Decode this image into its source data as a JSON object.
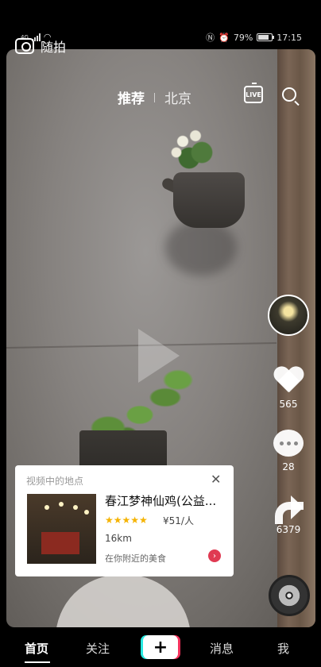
{
  "status_bar": {
    "network": "4G",
    "battery": "79%",
    "battery_level": 0.79,
    "time": "17:15"
  },
  "top_nav": {
    "camera_label": "随拍",
    "tab_main": "推荐",
    "tab_city": "北京",
    "live_label": "LIVE"
  },
  "rail": {
    "likes": "565",
    "comments": "28",
    "shares": "6379"
  },
  "card": {
    "header": "视频中的地点",
    "close": "✕",
    "place_name": "春江梦神仙鸡(公益...",
    "rating_stars": 4.5,
    "stars_text": "★★★★★",
    "price": "¥51/人",
    "distance": "16km",
    "nearby": "在你附近的美食",
    "go": "›"
  },
  "bottom_nav": {
    "home": "首页",
    "follow": "关注",
    "add": "+",
    "messages": "消息",
    "me": "我"
  }
}
